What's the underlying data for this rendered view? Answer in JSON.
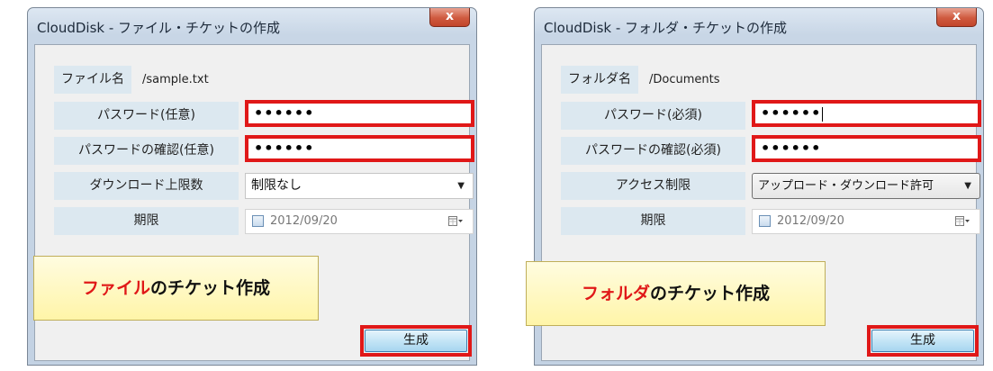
{
  "left_dialog": {
    "title": "CloudDisk - ファイル・チケットの作成",
    "close_glyph": "x",
    "name_label": "ファイル名",
    "name_value": "/sample.txt",
    "password_label": "パスワード(任意)",
    "password_value": "••••••",
    "confirm_label": "パスワードの確認(任意)",
    "confirm_value": "••••••",
    "limit_label": "ダウンロード上限数",
    "limit_value": "制限なし",
    "expiry_label": "期限",
    "expiry_value": "2012/09/20",
    "generate_label": "生成"
  },
  "right_dialog": {
    "title": "CloudDisk - フォルダ・チケットの作成",
    "close_glyph": "x",
    "name_label": "フォルダ名",
    "name_value": "/Documents",
    "password_label": "パスワード(必須)",
    "password_value": "••••••",
    "confirm_label": "パスワードの確認(必須)",
    "confirm_value": "••••••",
    "access_label": "アクセス制限",
    "access_value": "アップロード・ダウンロード許可",
    "expiry_label": "期限",
    "expiry_value": "2012/09/20",
    "generate_label": "生成"
  },
  "callouts": {
    "file_highlight": "ファイル",
    "file_rest": "のチケット作成",
    "folder_highlight": "フォルダ",
    "folder_rest": "のチケット作成"
  },
  "colors": {
    "highlight_red": "#e01818",
    "callout_yellow": "#fff5a8",
    "label_blue": "#dce8f0"
  }
}
